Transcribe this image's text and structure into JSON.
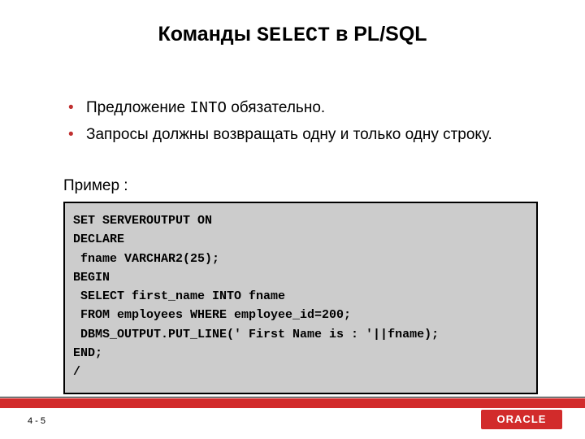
{
  "title": {
    "pre": "Команды ",
    "mono": "SELECT",
    "post": " в PL/SQL"
  },
  "bullets": [
    {
      "pre": "Предложение ",
      "mono": "INTO",
      "post": " обязательно."
    },
    {
      "pre": "Запросы должны возвращать одну и только одну строку.",
      "mono": "",
      "post": ""
    }
  ],
  "example_label": "Пример :",
  "code": "SET SERVEROUTPUT ON\nDECLARE\n fname VARCHAR2(25);\nBEGIN\n SELECT first_name INTO fname\n FROM employees WHERE employee_id=200;\n DBMS_OUTPUT.PUT_LINE(' First Name is : '||fname);\nEND;\n/",
  "footer": {
    "page": "4 - 5",
    "logo": "ORACLE"
  }
}
